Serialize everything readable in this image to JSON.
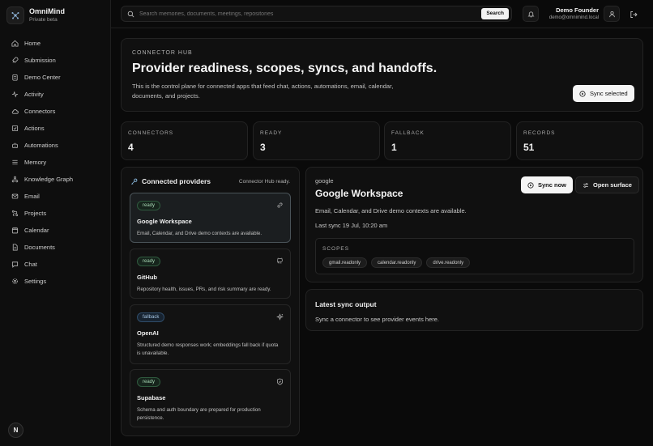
{
  "brand": {
    "name": "OmniMind",
    "subtitle": "Private beta"
  },
  "sidebar": {
    "items": [
      {
        "label": "Home",
        "icon": "home-icon"
      },
      {
        "label": "Submission",
        "icon": "rocket-icon"
      },
      {
        "label": "Demo Center",
        "icon": "clipboard-icon"
      },
      {
        "label": "Activity",
        "icon": "activity-icon"
      },
      {
        "label": "Connectors",
        "icon": "cloud-icon"
      },
      {
        "label": "Actions",
        "icon": "check-square-icon"
      },
      {
        "label": "Automations",
        "icon": "bot-icon"
      },
      {
        "label": "Memory",
        "icon": "list-icon"
      },
      {
        "label": "Knowledge Graph",
        "icon": "graph-icon"
      },
      {
        "label": "Email",
        "icon": "mail-icon"
      },
      {
        "label": "Projects",
        "icon": "route-icon"
      },
      {
        "label": "Calendar",
        "icon": "calendar-icon"
      },
      {
        "label": "Documents",
        "icon": "file-icon"
      },
      {
        "label": "Chat",
        "icon": "chat-icon"
      },
      {
        "label": "Settings",
        "icon": "gear-icon"
      }
    ],
    "avatar_letter": "N"
  },
  "topbar": {
    "search_placeholder": "Search memories, documents, meetings, repositories",
    "search_button": "Search",
    "user_name": "Demo Founder",
    "user_email": "demo@omnimind.local"
  },
  "hero": {
    "kicker": "CONNECTOR HUB",
    "title": "Provider readiness, scopes, syncs, and handoffs.",
    "description": "This is the control plane for connected apps that feed chat, actions, automations, email, calendar, documents, and projects.",
    "sync_button": "Sync selected"
  },
  "stats": [
    {
      "label": "CONNECTORS",
      "value": "4"
    },
    {
      "label": "READY",
      "value": "3"
    },
    {
      "label": "FALLBACK",
      "value": "1"
    },
    {
      "label": "RECORDS",
      "value": "51"
    }
  ],
  "providers": {
    "title": "Connected providers",
    "status": "Connector Hub ready.",
    "items": [
      {
        "status": "ready",
        "name": "Google Workspace",
        "description": "Email, Calendar, and Drive demo contexts are available.",
        "icon": "link-icon"
      },
      {
        "status": "ready",
        "name": "GitHub",
        "description": "Repository health, issues, PRs, and risk summary are ready.",
        "icon": "github-icon"
      },
      {
        "status": "fallback",
        "name": "OpenAI",
        "description": "Structured demo responses work; embeddings fall back if quota is unavailable.",
        "icon": "sparkles-icon"
      },
      {
        "status": "ready",
        "name": "Supabase",
        "description": "Schema and auth boundary are prepared for production persistence.",
        "icon": "shield-check-icon"
      }
    ]
  },
  "detail": {
    "kicker": "google",
    "title": "Google Workspace",
    "description": "Email, Calendar, and Drive demo contexts are available.",
    "last_sync": "Last sync 19 Jul, 10:20 am",
    "sync_now": "Sync now",
    "open_surface": "Open surface",
    "scopes_label": "SCOPES",
    "scopes": [
      "gmail.readonly",
      "calendar.readonly",
      "drive.readonly"
    ]
  },
  "output": {
    "title": "Latest sync output",
    "description": "Sync a connector to see provider events here."
  }
}
